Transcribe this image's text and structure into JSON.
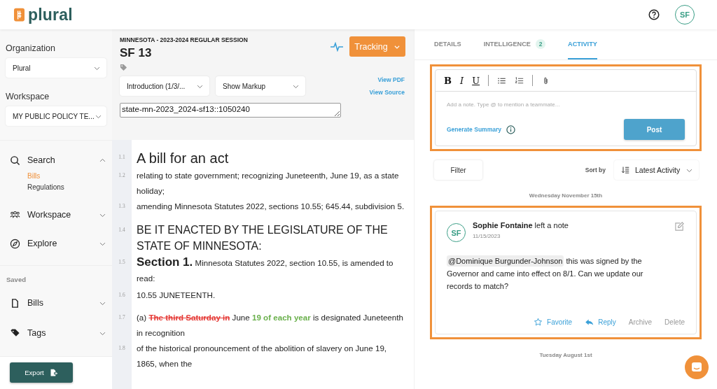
{
  "header": {
    "logo": "plural",
    "avatar": "SF"
  },
  "sidebar": {
    "organization": {
      "label": "Organization",
      "value": "Plural"
    },
    "workspace": {
      "label": "Workspace",
      "value": "MY PUBLIC POLICY TE..."
    },
    "nav": [
      {
        "label": "Search",
        "expanded": true,
        "children": [
          {
            "label": "Bills",
            "selected": true
          },
          {
            "label": "Regulations",
            "selected": false
          }
        ]
      },
      {
        "label": "Workspace",
        "expanded": false
      },
      {
        "label": "Explore",
        "expanded": false
      }
    ],
    "saved": {
      "heading": "Saved",
      "items": [
        {
          "label": "Bills",
          "expanded": false
        },
        {
          "label": "Tags",
          "expanded": false
        }
      ]
    },
    "export_button": "Export"
  },
  "bill": {
    "session": "MINNESOTA - 2023-2024 REGULAR SESSION",
    "title": "SF 13",
    "tracking_button": "Tracking",
    "version_select": "Introduction (1/3/...",
    "markup_select": "Show Markup",
    "links": [
      "View PDF",
      "View Source"
    ],
    "identifier": "state-mn-2023_2024-sf13::1050240",
    "lines": [
      {
        "number": "1.1",
        "segments": [
          {
            "kind": "title",
            "text": "A bill for an act"
          }
        ]
      },
      {
        "number": "1.2",
        "segments": [
          {
            "kind": "text",
            "text": "relating to state government; recognizing Juneteenth, June 19, as a state holiday;"
          }
        ]
      },
      {
        "number": "1.3",
        "segments": [
          {
            "kind": "text",
            "text": "amending Minnesota Statutes 2022, sections 10.55; 645.44, subdivision 5."
          }
        ]
      },
      {
        "number": "1.4",
        "segments": [
          {
            "kind": "heading",
            "text": "BE IT ENACTED BY THE LEGISLATURE OF THE STATE OF MINNESOTA:"
          }
        ]
      },
      {
        "number": "1.5",
        "segments": [
          {
            "kind": "section",
            "text": "Section 1."
          },
          {
            "kind": "text",
            "text": "Minnesota Statutes 2022, section 10.55, is amended to read:"
          }
        ]
      },
      {
        "number": "1.6",
        "segments": [
          {
            "kind": "text",
            "text": "10.55 JUNETEENTH."
          }
        ]
      },
      {
        "number": "1.7",
        "segments": [
          {
            "kind": "text",
            "text": "(a)"
          },
          {
            "kind": "deleted",
            "text": "The third Saturday in"
          },
          {
            "kind": "text",
            "text": "June"
          },
          {
            "kind": "inserted",
            "text": "19 of each year"
          },
          {
            "kind": "text",
            "text": "is designated Juneteenth in recognition"
          }
        ]
      },
      {
        "number": "1.8",
        "segments": [
          {
            "kind": "text",
            "text": "of the historical pronouncement of the abolition of slavery on June 19, 1865, when the"
          }
        ]
      }
    ]
  },
  "activity": {
    "tabs": [
      {
        "label": "DETAILS",
        "selected": false
      },
      {
        "label": "INTELLIGENCE",
        "badge": "2",
        "selected": false
      },
      {
        "label": "ACTIVITY",
        "selected": true
      }
    ],
    "editor": {
      "toolbar": [
        "B",
        "I",
        "U"
      ],
      "placeholder": "Add a note. Type @ to mention a teammate...",
      "generate_summary": "Generate Summary",
      "post_button": "Post"
    },
    "filter_button": "Filter",
    "sort_label": "Sort by",
    "sort_select": "Latest Activity",
    "groups": [
      {
        "date": "Wednesday November 15th",
        "notes": [
          {
            "avatar": "SF",
            "author": "Sophie Fontaine",
            "action": "left a note",
            "date": "11/15/2023",
            "mention": "@Dominique Burgunder-Johnson",
            "body": "this was signed by the Governor and came into effect on 8/1. Can we update our records to match?",
            "actions": [
              {
                "label": "Favorite",
                "kind": "favorite"
              },
              {
                "label": "Reply",
                "kind": "reply"
              },
              {
                "label": "Archive",
                "kind": "plain"
              },
              {
                "label": "Delete",
                "kind": "plain"
              }
            ]
          }
        ]
      },
      {
        "date": "Tuesday August 1st"
      }
    ]
  }
}
